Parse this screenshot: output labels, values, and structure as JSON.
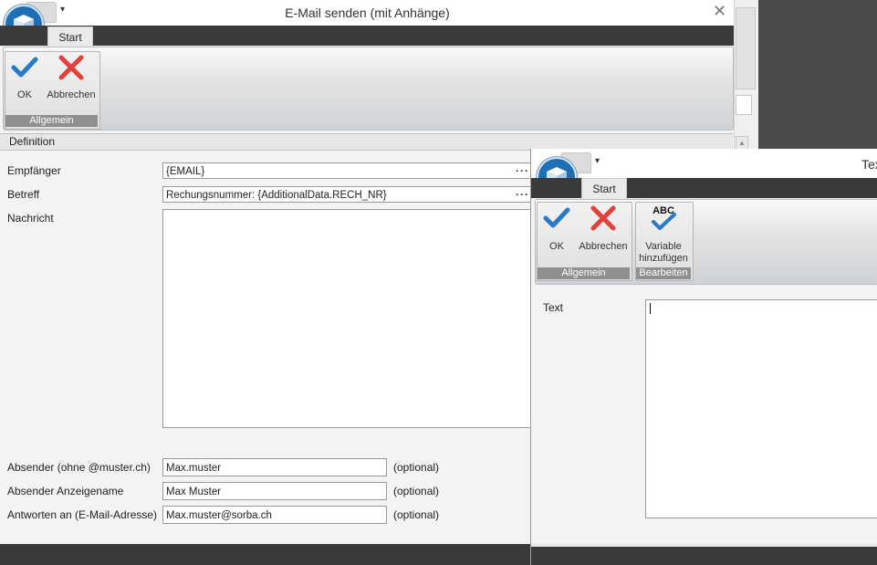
{
  "email_window": {
    "title": "E-Mail senden (mit Anhänge)",
    "tab": "Start",
    "ribbon": {
      "ok_label": "OK",
      "cancel_label": "Abbrechen",
      "group_label": "Allgemein"
    },
    "section_title": "Definition",
    "fields": {
      "recipient_label": "Empfänger",
      "recipient_value": "{EMAIL}",
      "subject_label": "Betreff",
      "subject_value": "Rechungsnummer: {AdditionalData.RECH_NR}",
      "message_label": "Nachricht",
      "sender_label": "Absender (ohne @muster.ch)",
      "sender_value": "Max.muster",
      "sender_name_label": "Absender Anzeigename",
      "sender_name_value": "Max Muster",
      "reply_label": "Antworten an (E-Mail-Adresse)",
      "reply_value": "Max.muster@sorba.ch",
      "optional": "(optional)"
    },
    "ellipsis": "···"
  },
  "text_window": {
    "title_visible": "Tex",
    "tab": "Start",
    "ribbon": {
      "ok_label": "OK",
      "cancel_label": "Abbrechen",
      "add_var_line1": "Variable",
      "add_var_line2": "hinzufügen",
      "abc": "ABC",
      "group_general": "Allgemein",
      "group_edit": "Bearbeiten"
    },
    "text_label": "Text"
  },
  "colors": {
    "check": "#2a79c9",
    "cross": "#e2403a",
    "logo": "#1f6fb8"
  }
}
